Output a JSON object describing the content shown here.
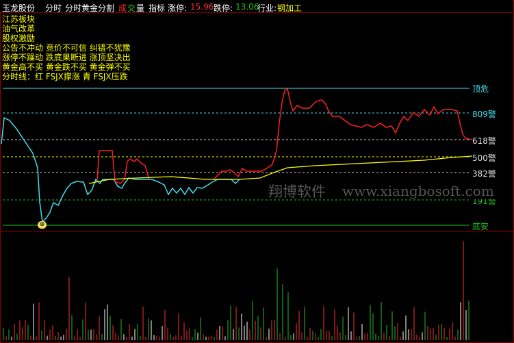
{
  "header": {
    "stock_name": "玉龙股份",
    "menu": [
      "分时",
      "分时黄金分割"
    ],
    "cheng": "成",
    "jiao": "交",
    "liang": "量",
    "indicator": "指标",
    "limit_up_label": "涨停:",
    "limit_up_value": "15.96",
    "limit_down_label": "跌停:",
    "limit_down_value": "13.06",
    "industry_label": "行业:",
    "industry_value": "钢加工"
  },
  "legend": [
    "江苏板块",
    "油气改革",
    "股权激励",
    "公告不冲动  竞价不可信  纠错不犹豫",
    "涨停不躁动  跌底果断进  涨顶坚决出",
    "黄金高不买  黄金跌不买  黄金弹不买",
    "分时线：红 FSJX撑涨    青 FSJX压跌"
  ],
  "levels": {
    "top": "顶危",
    "l809": "809警",
    "l618": "618警",
    "l500": "500警",
    "l382": "382警",
    "l191": "191警",
    "bottom": "底安"
  },
  "marker": "⊕",
  "watermark": {
    "cn": "翔博软件",
    "en": "www.xiangbosoft.com"
  },
  "colors": {
    "background": "#000000",
    "frame": "#8b0000",
    "price_up": "#ff2020",
    "price_down": "#40e0f0",
    "average": "#ffff00",
    "level_cyan": "#40e0f0",
    "level_white": "#cccccc",
    "level_green": "#20c020",
    "volume_up": "#ff3030",
    "volume_down": "#20c020",
    "volume_neutral": "#ffffff"
  }
}
